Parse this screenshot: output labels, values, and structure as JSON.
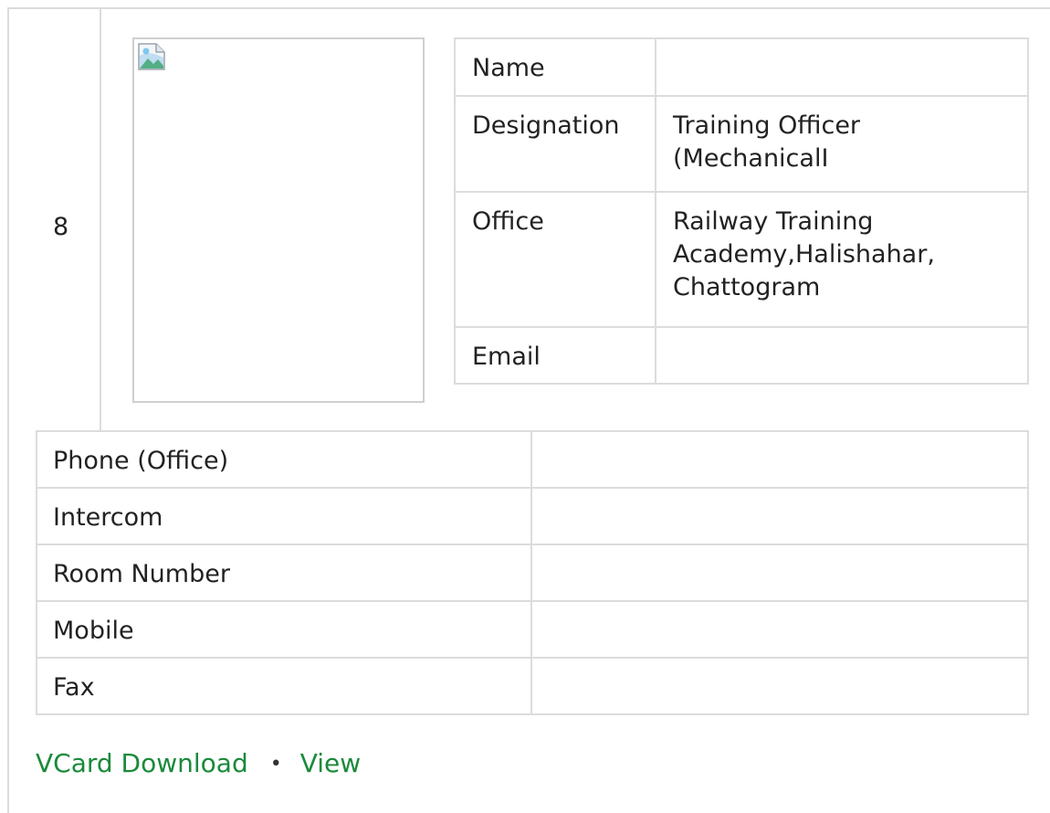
{
  "entry": {
    "index": "8"
  },
  "info": {
    "rows": [
      {
        "label": "Name",
        "value": ""
      },
      {
        "label": "Designation",
        "value": "Training Officer (MechanicalI"
      },
      {
        "label": "Office",
        "value": "Railway Training Academy,Halishahar, Chattogram"
      },
      {
        "label": "Email",
        "value": ""
      }
    ]
  },
  "contact": {
    "rows": [
      {
        "label": "Phone (Office)",
        "value": ""
      },
      {
        "label": "Intercom",
        "value": ""
      },
      {
        "label": "Room Number",
        "value": ""
      },
      {
        "label": "Mobile",
        "value": ""
      },
      {
        "label": "Fax",
        "value": ""
      }
    ]
  },
  "footer": {
    "vcard_label": "VCard Download",
    "separator": "•",
    "view_label": "View",
    "link_color": "#1a8a3b"
  },
  "icons": {
    "photo_placeholder": "broken-image-icon"
  }
}
